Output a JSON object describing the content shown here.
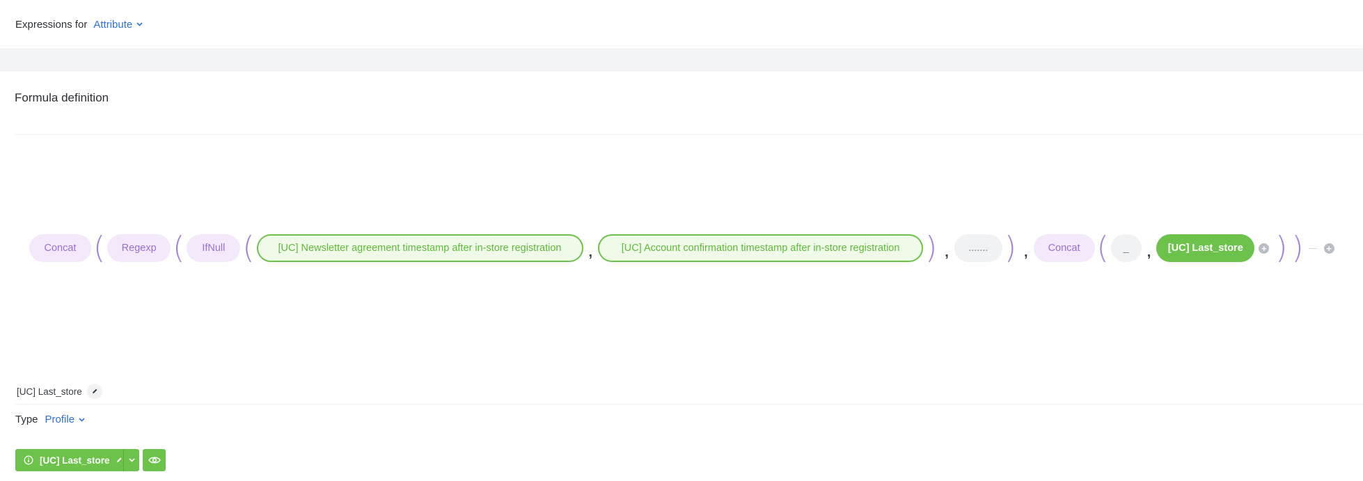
{
  "header": {
    "label": "Expressions for",
    "attribute": "Attribute"
  },
  "section": {
    "title": "Formula definition"
  },
  "formula": {
    "concat1": "Concat",
    "regexp": "Regexp",
    "ifnull": "IfNull",
    "attr1": "[UC] Newsletter agreement timestamp after in-store registration",
    "attr2": "[UC] Account confirmation timestamp after in-store registration",
    "placeholder": ".......",
    "concat2": "Concat",
    "underscore": "_",
    "selected": "[UC] Last_store",
    "paren_open": "(",
    "paren_close": ")",
    "comma": ",",
    "plus": "+"
  },
  "field": {
    "name": "[UC] Last_store"
  },
  "type": {
    "label": "Type",
    "value": "Profile"
  },
  "button": {
    "label": "[UC] Last_store"
  },
  "colors": {
    "green": "#6cc24a",
    "purple": "#a380e0",
    "blue": "#2d6fe0"
  }
}
